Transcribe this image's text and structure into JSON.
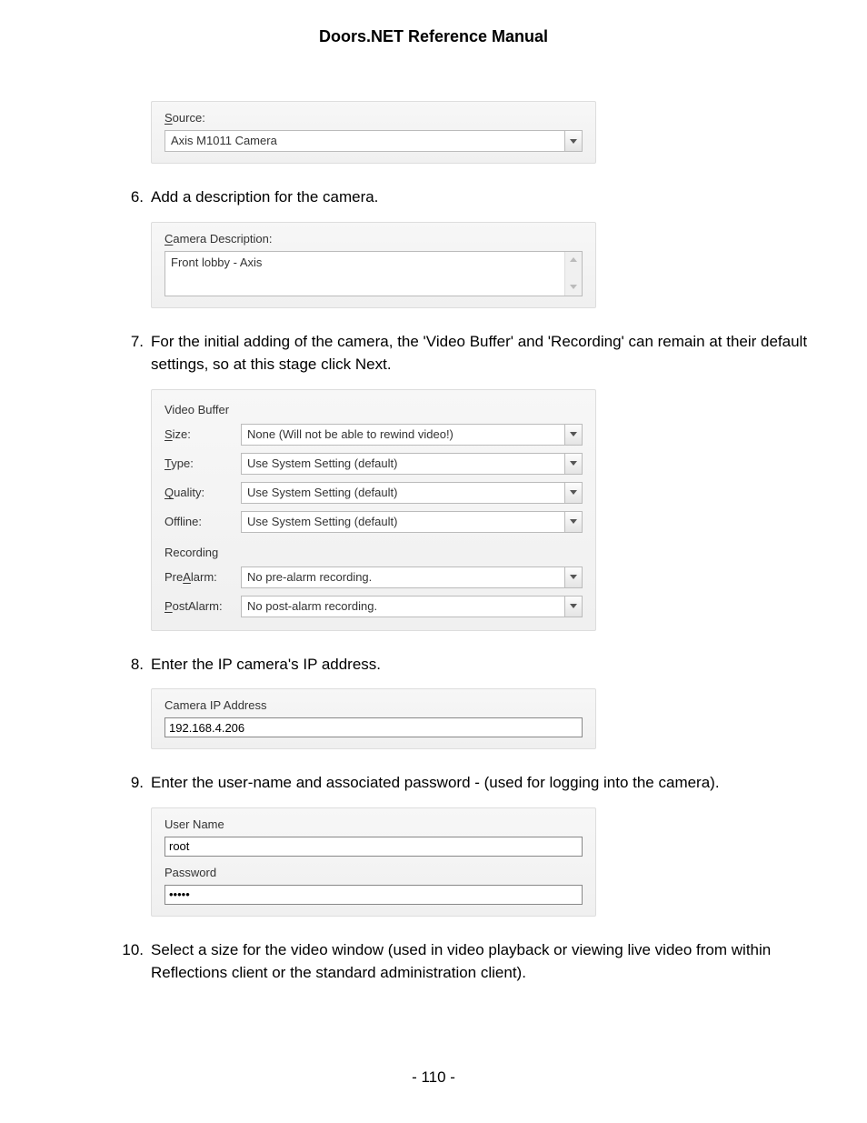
{
  "title": "Doors.NET Reference Manual",
  "page_number": "- 110 -",
  "source_panel": {
    "label_underlined": "S",
    "label_rest": "ource:",
    "value": "Axis M1011 Camera"
  },
  "step6": {
    "num": "6.",
    "text": "Add a description for the camera."
  },
  "desc_panel": {
    "label_underlined": "C",
    "label_rest": "amera Description:",
    "value": "Front lobby - Axis"
  },
  "step7": {
    "num": "7.",
    "text": "For the initial adding of the camera, the 'Video Buffer' and 'Recording' can remain at their default settings, so at this stage click Next."
  },
  "buffer_panel": {
    "group1_title": "Video Buffer",
    "size_label_u": "S",
    "size_label_r": "ize:",
    "size_value": "None (Will not be able to rewind video!)",
    "type_label_u": "T",
    "type_label_r": "ype:",
    "type_value": "Use System Setting (default)",
    "quality_label_u": "Q",
    "quality_label_r": "uality:",
    "quality_value": "Use System Setting (default)",
    "offline_label": "Offline:",
    "offline_value": "Use System Setting (default)",
    "group2_title": "Recording",
    "prealarm_label_pre": "Pre",
    "prealarm_label_u": "A",
    "prealarm_label_post": "larm:",
    "prealarm_value": "No pre-alarm recording.",
    "postalarm_label_u": "P",
    "postalarm_label_r": "ostAlarm:",
    "postalarm_value": "No post-alarm recording."
  },
  "step8": {
    "num": "8.",
    "text": "Enter the IP camera's IP address."
  },
  "ip_panel": {
    "label": "Camera IP Address",
    "value": "192.168.4.206"
  },
  "step9": {
    "num": "9.",
    "text": "Enter the user-name and associated password - (used for logging into the camera)."
  },
  "cred_panel": {
    "user_label": "User Name",
    "user_value": "root",
    "pass_label": "Password",
    "pass_value": "•••••"
  },
  "step10": {
    "num": "10.",
    "text": "Select a size for the video window (used in video playback or viewing live video from within Reflections client or the standard administration client)."
  }
}
